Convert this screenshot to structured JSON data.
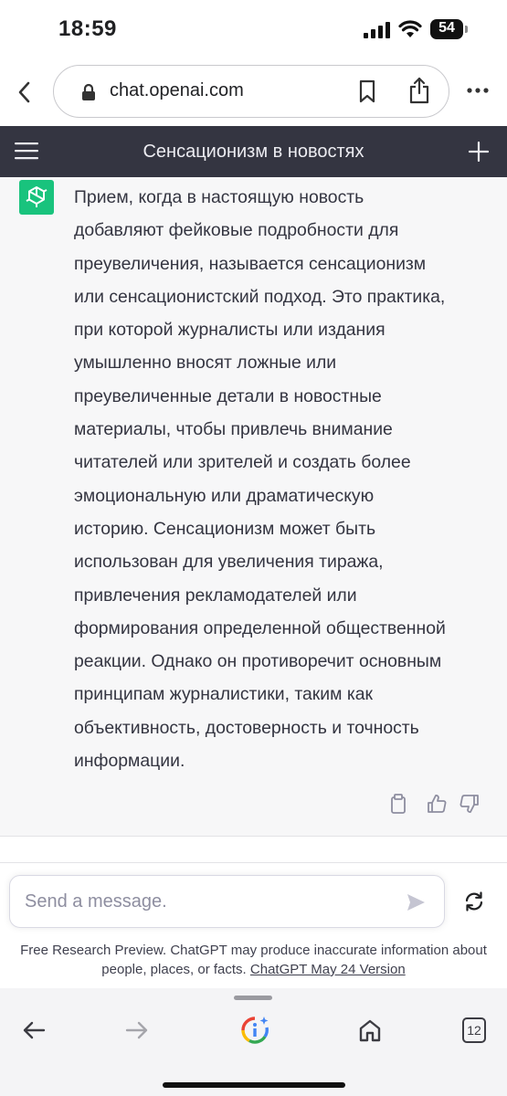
{
  "status_bar": {
    "time": "18:59",
    "battery_level": "54",
    "icons": [
      "signal-icon",
      "wifi-icon",
      "battery-icon"
    ]
  },
  "browser": {
    "url": "chat.openai.com",
    "icons": [
      "back-chevron-icon",
      "lock-icon",
      "bookmark-icon",
      "share-icon",
      "more-icon"
    ]
  },
  "chat_header": {
    "title": "Сенсационизм в новостях",
    "icons": [
      "menu-icon",
      "plus-icon"
    ]
  },
  "assistant_message": {
    "lines": [
      "Прием, когда в настоящую новость",
      "добавляют фейковые подробности для",
      "преувеличения, называется сенсационизм",
      "или сенсационистский подход. Это практика,",
      "при которой журналисты или издания",
      "умышленно вносят ложные или",
      "преувеличенные детали в новостные",
      "материалы, чтобы привлечь внимание",
      "читателей или зрителей и создать более",
      "эмоциональную или драматическую",
      "историю. Сенсационизм может быть",
      "использован для увеличения тиража,",
      "привлечения рекламодателей или",
      "формирования определенной общественной",
      "реакции. Однако он противоречит основным",
      "принципам журналистики, таким как",
      "объективность, достоверность и точность",
      "информации."
    ],
    "actions": [
      "copy-icon",
      "thumbs-up-icon",
      "thumbs-down-icon"
    ]
  },
  "composer": {
    "placeholder": "Send a message.",
    "icons": [
      "send-icon",
      "regenerate-icon"
    ]
  },
  "disclaimer": {
    "line1": "Free Research Preview. ChatGPT may produce inaccurate information about",
    "line2_prefix": "people, places, or facts. ",
    "link": "ChatGPT May 24 Version"
  },
  "bottom_toolbar": {
    "tab_count": "12",
    "icons": [
      "nav-back-icon",
      "nav-forward-icon",
      "google-icon",
      "home-icon",
      "tabs-icon"
    ]
  },
  "colors": {
    "header_bg": "#343541",
    "message_bg": "#f7f7f8",
    "avatar_green": "#19c37d",
    "text": "#343541"
  }
}
